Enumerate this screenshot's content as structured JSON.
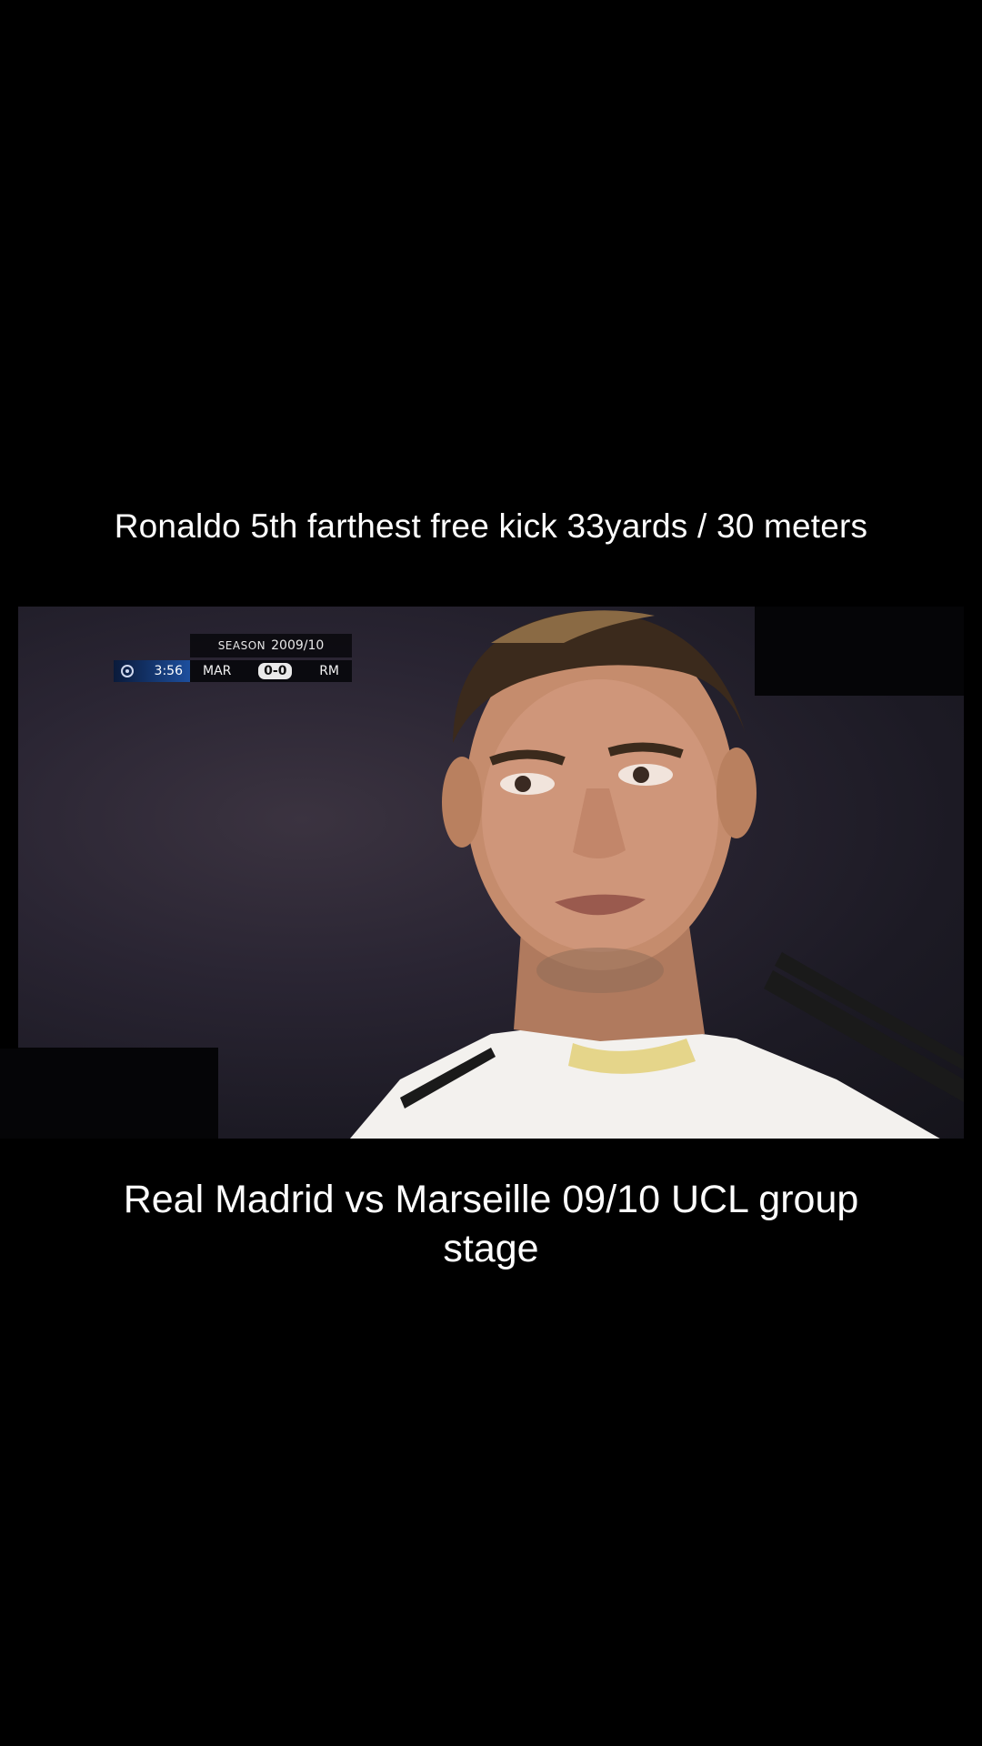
{
  "captions": {
    "top": "Ronaldo 5th farthest free kick 33yards / 30 meters",
    "bottom": "Real Madrid vs Marseille 09/10 UCL group stage"
  },
  "video": {
    "scoreboard": {
      "season_label": "SEASON",
      "season_value": "2009/10",
      "clock": "3:56",
      "home_team": "MAR",
      "score": "0-0",
      "away_team": "RM",
      "icon": "champions-league-ball-icon"
    }
  },
  "colors": {
    "background": "#000000",
    "text": "#ffffff",
    "scoreboard_blue": "#1d4f9e"
  }
}
